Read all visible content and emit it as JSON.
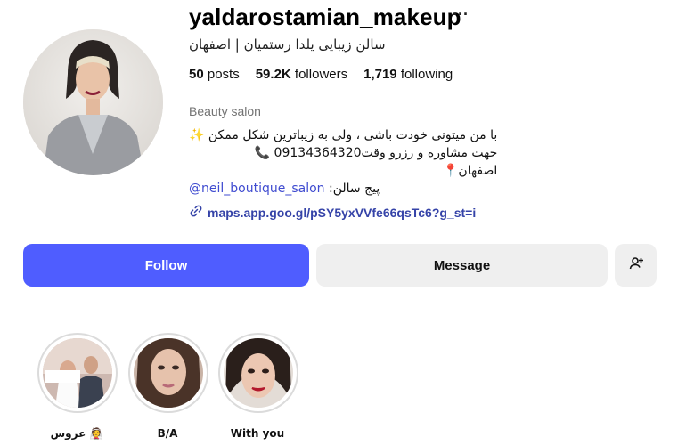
{
  "profile": {
    "username": "yaldarostamian_makeup",
    "more_icon": "···",
    "full_name": "سالن زیبایی یلدا رستمیان | اصفهان",
    "stats": {
      "posts_value": "50",
      "posts_label": "posts",
      "followers_value": "59.2K",
      "followers_label": "followers",
      "following_value": "1,719",
      "following_label": "following"
    },
    "category": "Beauty salon",
    "bio": {
      "line1": "با من میتونی خودت باشی ، ولی به زیباترین شکل ممکن ✨",
      "line2": "جهت مشاوره و رزرو وقت09134364320 📞",
      "line3": "اصفهان📍",
      "line4_prefix": "پیج سالن: ",
      "line4_mention": "@neil_boutique_salon"
    },
    "link": "maps.app.goo.gl/pSY5yxVVfe66qsTc6?g_st=i"
  },
  "actions": {
    "follow_label": "Follow",
    "message_label": "Message"
  },
  "highlights": [
    {
      "label": "عروس 👰"
    },
    {
      "label": "B/A"
    },
    {
      "label": "With you"
    }
  ],
  "icons": {
    "link": "link-icon",
    "add_user": "add-user-icon",
    "more": "more-options-icon"
  },
  "colors": {
    "follow_button": "#4f5dff",
    "secondary_button": "#efefef",
    "link": "#3543a8",
    "category": "#737373"
  }
}
